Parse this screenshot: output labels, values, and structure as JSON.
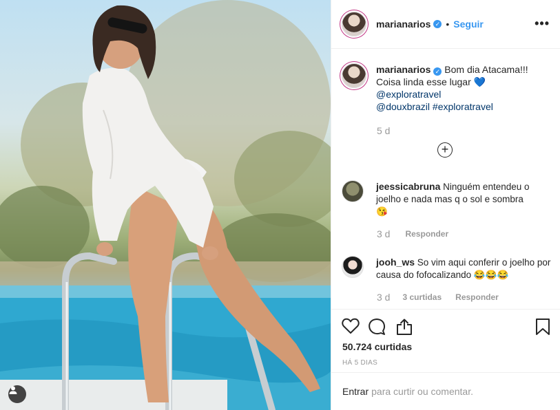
{
  "post": {
    "photo_icon": "user-tag-icon"
  },
  "header": {
    "username": "marianarios",
    "verified_icon": "verified-badge-icon",
    "separator": "•",
    "follow_label": "Seguir",
    "more_icon": "more-options-icon"
  },
  "caption": {
    "username": "marianarios",
    "line1": "Bom dia Atacama!!!",
    "line2": "Coisa linda esse lugar",
    "heart_emoji": "💙",
    "mention1": "@exploratravel",
    "mention2": "@douxbrazil",
    "hashtag": "#exploratravel",
    "time": "5 d",
    "load_more_icon": "plus-circle-icon"
  },
  "comments": [
    {
      "username": "jeessicabruna",
      "text": "Ninguém entendeu o joelho e nada mas q o sol e sombra",
      "emoji": "😘",
      "time": "3 d",
      "reply_label": "Responder"
    },
    {
      "username": "jooh_ws",
      "text": "So vim aqui conferir o joelho por causa do fofocalizando",
      "emoji": "😂😂😂",
      "time": "3 d",
      "likes_label": "3 curtidas",
      "reply_label": "Responder"
    }
  ],
  "actions": {
    "like_icon": "heart-icon",
    "comment_icon": "comment-icon",
    "share_icon": "share-icon",
    "save_icon": "bookmark-icon",
    "likes": "50.724 curtidas",
    "date": "HÁ 5 DIAS"
  },
  "login": {
    "enter_label": "Entrar",
    "rest": "para curtir ou comentar."
  },
  "colors": {
    "link": "#003569",
    "accent": "#3897f0",
    "muted": "#999999"
  }
}
